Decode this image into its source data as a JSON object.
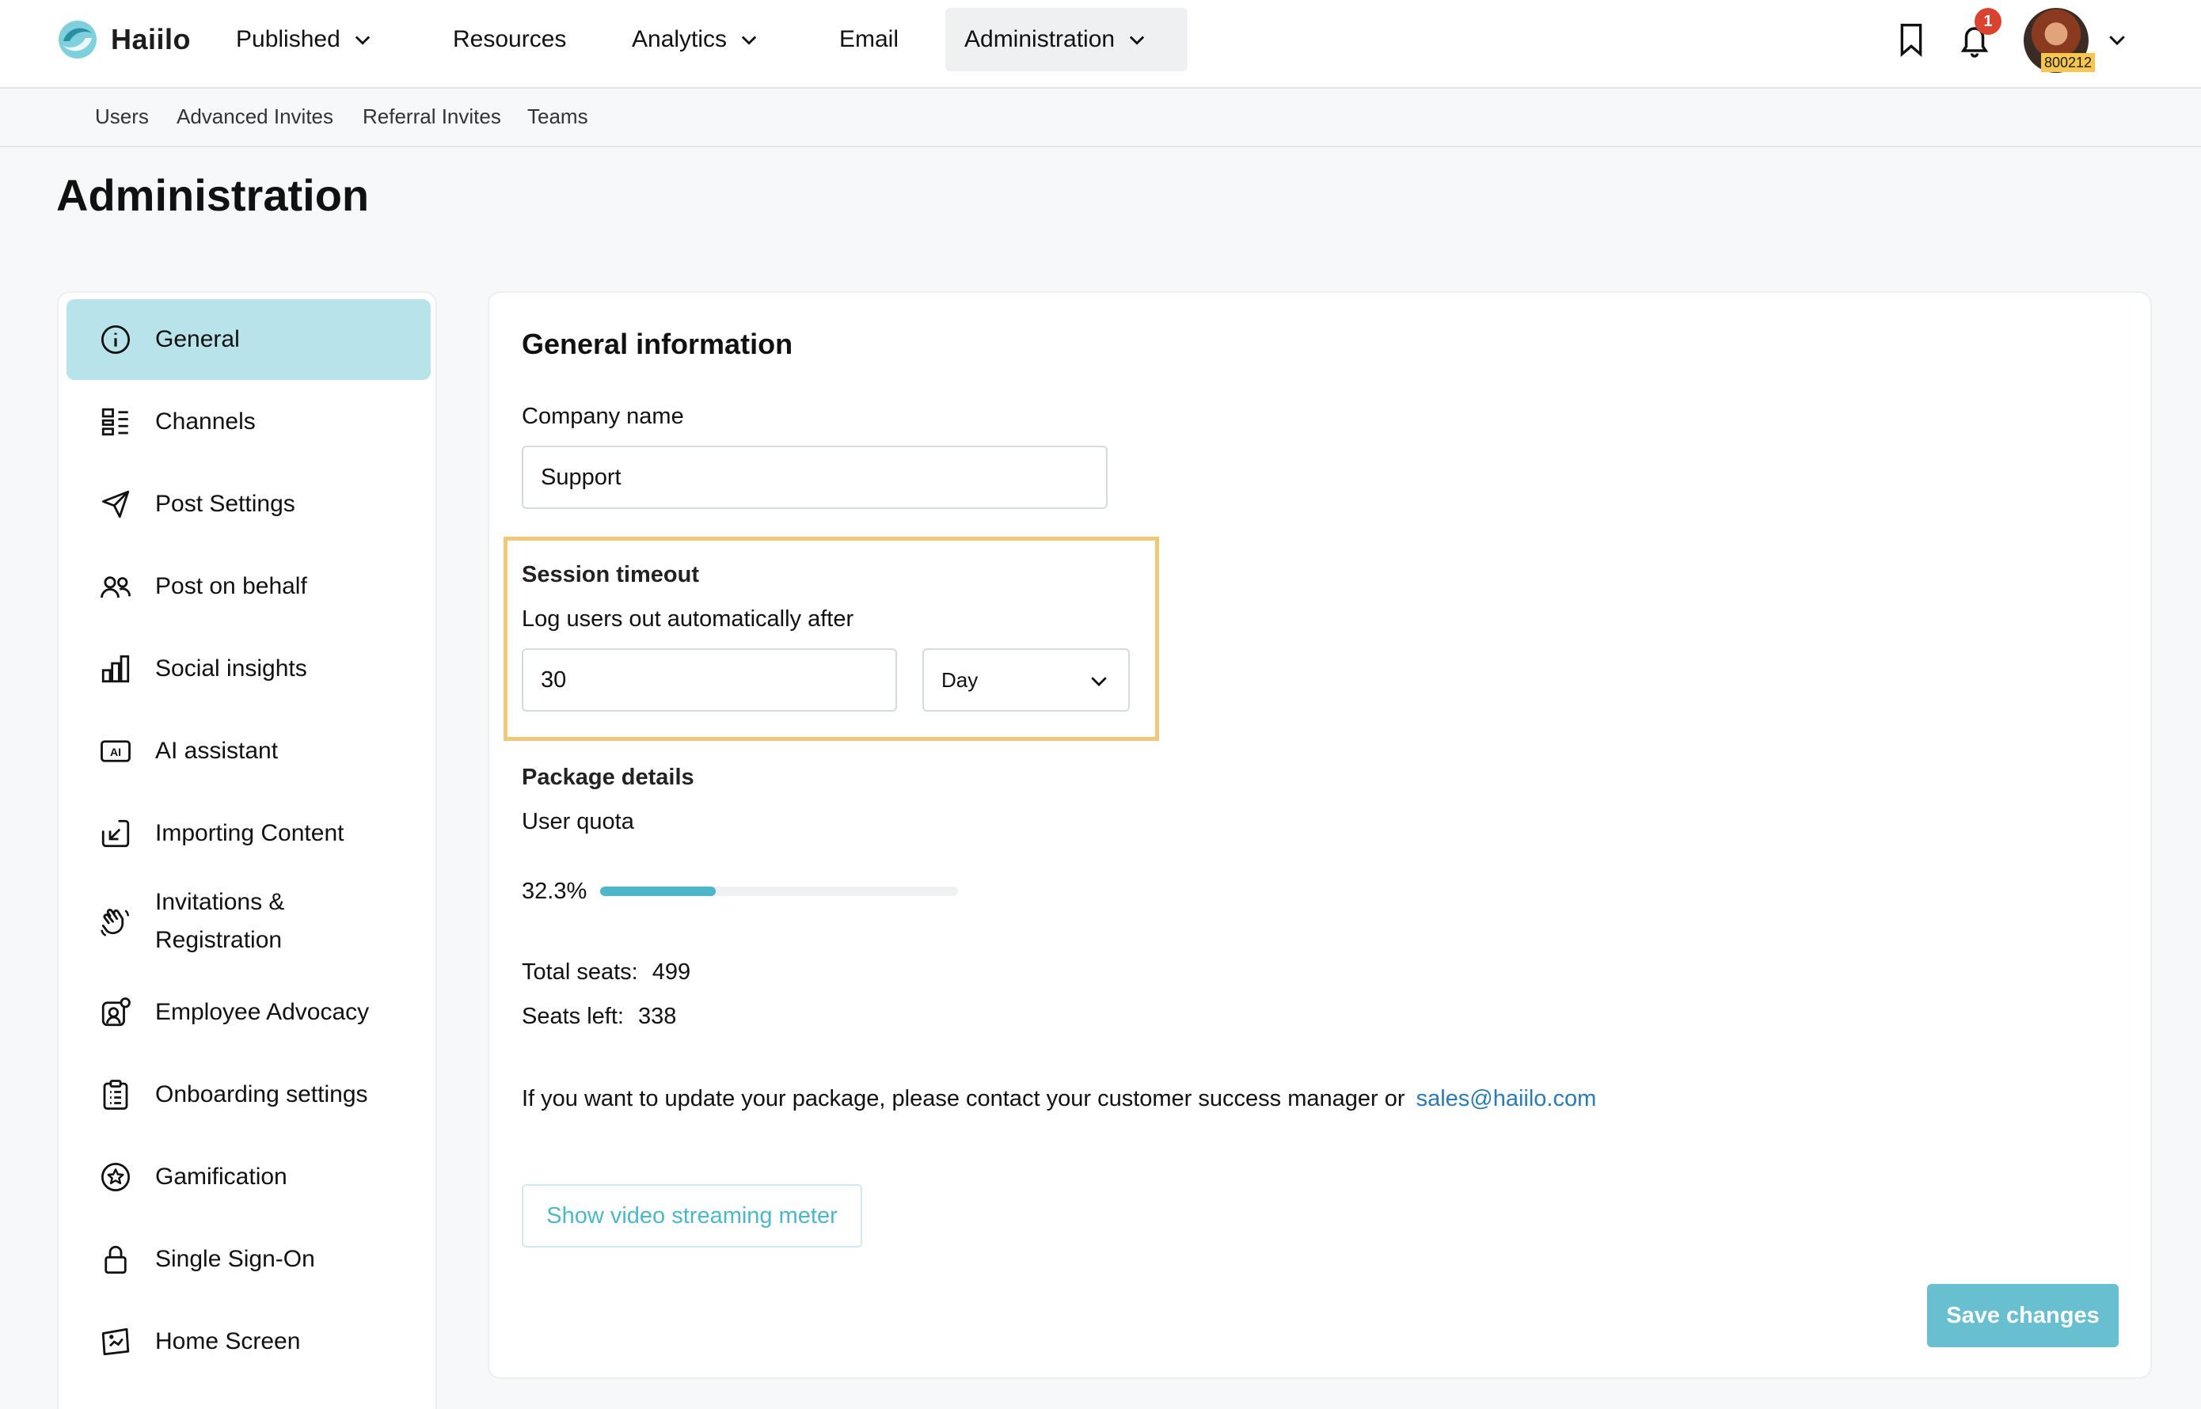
{
  "app": {
    "brand": "Haiilo",
    "accent": "#4db6c9",
    "highlight_color": "#f1c77a"
  },
  "topnav": {
    "items": [
      {
        "label": "Published",
        "has_dropdown": true
      },
      {
        "label": "Resources",
        "has_dropdown": false
      },
      {
        "label": "Analytics",
        "has_dropdown": true
      },
      {
        "label": "Email",
        "has_dropdown": false
      },
      {
        "label": "Administration",
        "has_dropdown": true,
        "active": true
      }
    ],
    "icons": [
      "bookmark-icon",
      "bell-icon"
    ],
    "notification_count": "1",
    "avatar_tag": "800212"
  },
  "subnav": {
    "items": [
      "Users",
      "Advanced Invites",
      "Referral Invites",
      "Teams"
    ]
  },
  "page": {
    "title": "Administration"
  },
  "sidebar": {
    "items": [
      {
        "label": "General",
        "icon": "info-icon",
        "active": true
      },
      {
        "label": "Channels",
        "icon": "channels-icon"
      },
      {
        "label": "Post Settings",
        "icon": "send-icon"
      },
      {
        "label": "Post on behalf",
        "icon": "users-icon"
      },
      {
        "label": "Social insights",
        "icon": "bar-chart-icon"
      },
      {
        "label": "AI assistant",
        "icon": "ai-icon"
      },
      {
        "label": "Importing Content",
        "icon": "import-icon"
      },
      {
        "label": "Invitations &",
        "label2": "Registration",
        "icon": "waving-hand-icon"
      },
      {
        "label": "Employee Advocacy",
        "icon": "advocacy-icon"
      },
      {
        "label": "Onboarding settings",
        "icon": "clipboard-icon"
      },
      {
        "label": "Gamification",
        "icon": "star-badge-icon"
      },
      {
        "label": "Single Sign-On",
        "icon": "lock-icon"
      },
      {
        "label": "Home Screen",
        "icon": "home-screen-icon"
      }
    ]
  },
  "general": {
    "heading": "General information",
    "company_name": {
      "label": "Company name",
      "value": "Support"
    },
    "session_timeout": {
      "heading": "Session timeout",
      "description": "Log users out automatically after",
      "value": "30",
      "unit": "Day"
    },
    "package": {
      "heading": "Package details",
      "quota_label": "User quota",
      "quota_percent_text": "32.3%",
      "quota_fraction": 0.323,
      "total_seats_label": "Total seats:",
      "total_seats": "499",
      "seats_left_label": "Seats left:",
      "seats_left": "338",
      "contact_text": "If you want to update your package, please contact your customer success manager or",
      "contact_email": "sales@haiilo.com"
    },
    "video_button": "Show video streaming meter",
    "save_button": "Save changes"
  }
}
